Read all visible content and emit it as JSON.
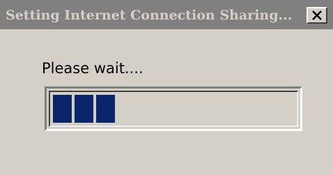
{
  "window": {
    "title": "Setting Internet Connection Sharing..."
  },
  "titlebar": {
    "close_label": "Close"
  },
  "body": {
    "message": "Please wait...."
  },
  "progress": {
    "fraction": 0.27,
    "blocks_shown": 3,
    "fill_color": "#0a246a"
  },
  "colors": {
    "window_background": "#d4d0c8",
    "titlebar_inactive": "#808080",
    "title_text": "#d4d0c8"
  },
  "icons": {
    "close": "close-icon"
  }
}
